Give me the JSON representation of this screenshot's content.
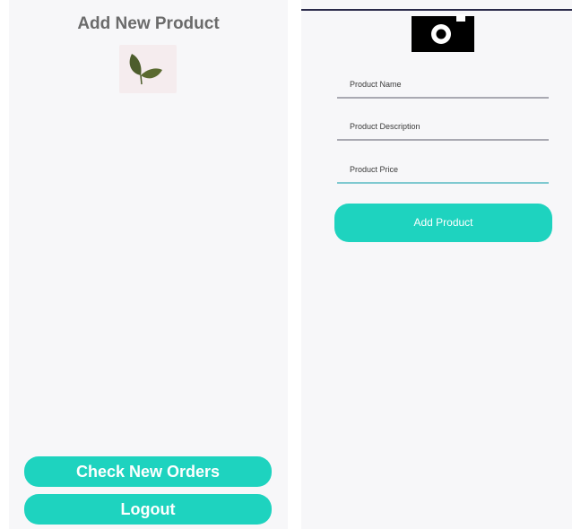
{
  "left_screen": {
    "title": "Add New Product",
    "product_image": "leaf-sprout-image",
    "check_orders_label": "Check New Orders",
    "logout_label": "Logout"
  },
  "right_screen": {
    "camera_icon": "camera-icon",
    "fields": {
      "name_placeholder": "Product Name",
      "description_placeholder": "Product Description",
      "price_placeholder": "Product Price"
    },
    "add_product_label": "Add Product"
  },
  "colors": {
    "accent": "#1ed3bf",
    "screen_bg": "#f7f7f9",
    "title_text": "#6b6b6b"
  }
}
